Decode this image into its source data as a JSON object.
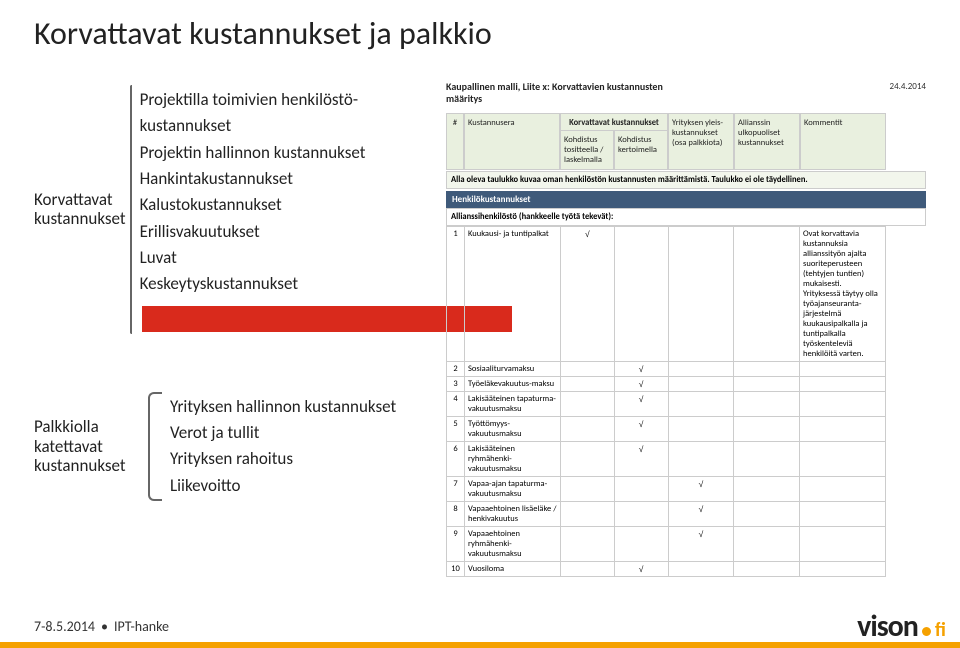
{
  "title": "Korvattavat kustannukset ja palkkio",
  "left": {
    "group1": {
      "label": "Korvattavat kustannukset",
      "items": [
        "Projektilla toimivien henkilöstö-\nkustannukset",
        "Projektin hallinnon kustannukset",
        "Hankintakustannukset",
        "Kalustokustannukset",
        "Erillisvakuutukset",
        "Luvat",
        "Keskeytyskustannukset"
      ]
    },
    "group2": {
      "label": "Palkkiolla katettavat kustannukset",
      "items": [
        "Yrityksen hallinnon kustannukset",
        "Verot ja tullit",
        "Yrityksen rahoitus",
        "Liikevoitto"
      ]
    }
  },
  "sheet": {
    "date": "24.4.2014",
    "title": "Kaupallinen malli, Liite x: Korvattavien kustannusten määritys",
    "header": {
      "group_top": "Korvattavat kustannukset",
      "num": "#",
      "name": "Kustannusera",
      "col_a": "Kohdistus tositteella / laskelmalla",
      "col_b": "Kohdistus kertoimella",
      "col_c": "Yrityksen yleis-kustannukset (osa palkkiota)",
      "col_d": "Allianssin ulkopuoliset kustannukset",
      "col_e": "Kommentit"
    },
    "note": "Alla oleva taulukko kuvaa oman henkilöstön kustannusten määrittämistä. Taulukko ei ole täydellinen.",
    "section": "Henkilökustannukset",
    "subsection": "Allianssihenkilöstö (hankkeelle työtä tekevät):",
    "rows": [
      {
        "n": "1",
        "name": "Kuukausi- ja tuntipalkat",
        "a": "√",
        "b": "",
        "c": "",
        "d": "",
        "e": "Ovat korvattavia kustannuksia allianssityön ajalta suoriteperusteen (tehtyjen tuntien) mukaisesti.\nYrityksessä täytyy olla työajanseuranta-järjestelmä kuukausipalkalla ja tuntipalkalla työskenteleviä henkilöitä varten."
      },
      {
        "n": "2",
        "name": "Sosiaaliturvamaksu",
        "a": "",
        "b": "√",
        "c": "",
        "d": "",
        "e": ""
      },
      {
        "n": "3",
        "name": "Työeläkevakuutus-maksu",
        "a": "",
        "b": "√",
        "c": "",
        "d": "",
        "e": ""
      },
      {
        "n": "4",
        "name": "Lakisääteinen tapaturma-vakuutusmaksu",
        "a": "",
        "b": "√",
        "c": "",
        "d": "",
        "e": ""
      },
      {
        "n": "5",
        "name": "Työttömyys-vakuutusmaksu",
        "a": "",
        "b": "√",
        "c": "",
        "d": "",
        "e": ""
      },
      {
        "n": "6",
        "name": "Lakisääteinen ryhmähenki-vakuutusmaksu",
        "a": "",
        "b": "√",
        "c": "",
        "d": "",
        "e": ""
      },
      {
        "n": "7",
        "name": "Vapaa-ajan tapaturma-vakuutusmaksu",
        "a": "",
        "b": "",
        "c": "√",
        "d": "",
        "e": ""
      },
      {
        "n": "8",
        "name": "Vapaaehtoinen lisäeläke / henkivakuutus",
        "a": "",
        "b": "",
        "c": "√",
        "d": "",
        "e": ""
      },
      {
        "n": "9",
        "name": "Vapaaehtoinen ryhmähenki-vakuutusmaksu",
        "a": "",
        "b": "",
        "c": "√",
        "d": "",
        "e": ""
      },
      {
        "n": "10",
        "name": "Vuosiloma",
        "a": "",
        "b": "√",
        "c": "",
        "d": "",
        "e": ""
      }
    ]
  },
  "footer": {
    "date": "7-8.5.2014",
    "label": "IPT-hanke",
    "logo_text": "vison",
    "logo_tld": "fi"
  },
  "colors": {
    "red": "#d92a1c",
    "orange": "#f5a100",
    "head_bg": "#e9f0df",
    "section_bg": "#3f5a7a"
  }
}
